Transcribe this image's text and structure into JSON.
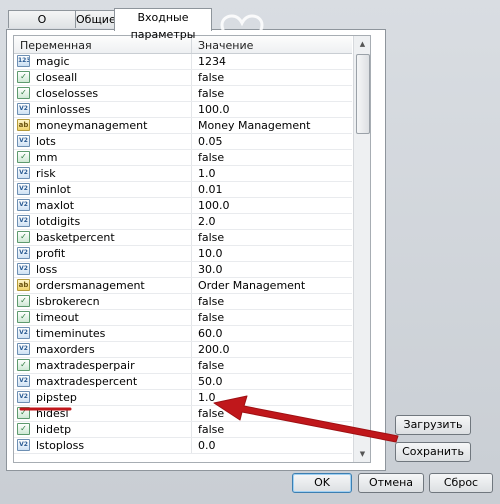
{
  "tabs": [
    "О программе",
    "Общие",
    "Входные параметры"
  ],
  "columns": {
    "name": "Переменная",
    "value": "Значение"
  },
  "params": [
    {
      "icon": "int",
      "name": "magic",
      "value": "1234"
    },
    {
      "icon": "bool",
      "name": "closeall",
      "value": "false"
    },
    {
      "icon": "bool",
      "name": "closelosses",
      "value": "false"
    },
    {
      "icon": "dbl",
      "name": "minlosses",
      "value": "100.0"
    },
    {
      "icon": "str",
      "name": "moneymanagement",
      "value": "Money Management"
    },
    {
      "icon": "dbl",
      "name": "lots",
      "value": "0.05"
    },
    {
      "icon": "bool",
      "name": "mm",
      "value": "false"
    },
    {
      "icon": "dbl",
      "name": "risk",
      "value": "1.0"
    },
    {
      "icon": "dbl",
      "name": "minlot",
      "value": "0.01"
    },
    {
      "icon": "dbl",
      "name": "maxlot",
      "value": "100.0"
    },
    {
      "icon": "dbl",
      "name": "lotdigits",
      "value": "2.0"
    },
    {
      "icon": "bool",
      "name": "basketpercent",
      "value": "false"
    },
    {
      "icon": "dbl",
      "name": "profit",
      "value": "10.0"
    },
    {
      "icon": "dbl",
      "name": "loss",
      "value": "30.0"
    },
    {
      "icon": "str",
      "name": "ordersmanagement",
      "value": "Order Management"
    },
    {
      "icon": "bool",
      "name": "isbrokerecn",
      "value": "false"
    },
    {
      "icon": "bool",
      "name": "timeout",
      "value": "false"
    },
    {
      "icon": "dbl",
      "name": "timeminutes",
      "value": "60.0"
    },
    {
      "icon": "dbl",
      "name": "maxorders",
      "value": "200.0"
    },
    {
      "icon": "bool",
      "name": "maxtradesperpair",
      "value": "false"
    },
    {
      "icon": "dbl",
      "name": "maxtradespercent",
      "value": "50.0"
    },
    {
      "icon": "dbl",
      "name": "pipstep",
      "value": "1.0"
    },
    {
      "icon": "bool",
      "name": "hidesl",
      "value": "false"
    },
    {
      "icon": "bool",
      "name": "hidetp",
      "value": "false"
    },
    {
      "icon": "dbl",
      "name": "lstoploss",
      "value": "0.0"
    }
  ],
  "icon_glyphs": {
    "int": "123",
    "bool": "✓",
    "str": "ab",
    "dbl": "V2"
  },
  "buttons": {
    "load": "Загрузить",
    "save": "Сохранить",
    "ok": "OK",
    "cancel": "Отмена",
    "reset": "Сброс"
  },
  "annotation": {
    "color": "#c0171b"
  }
}
